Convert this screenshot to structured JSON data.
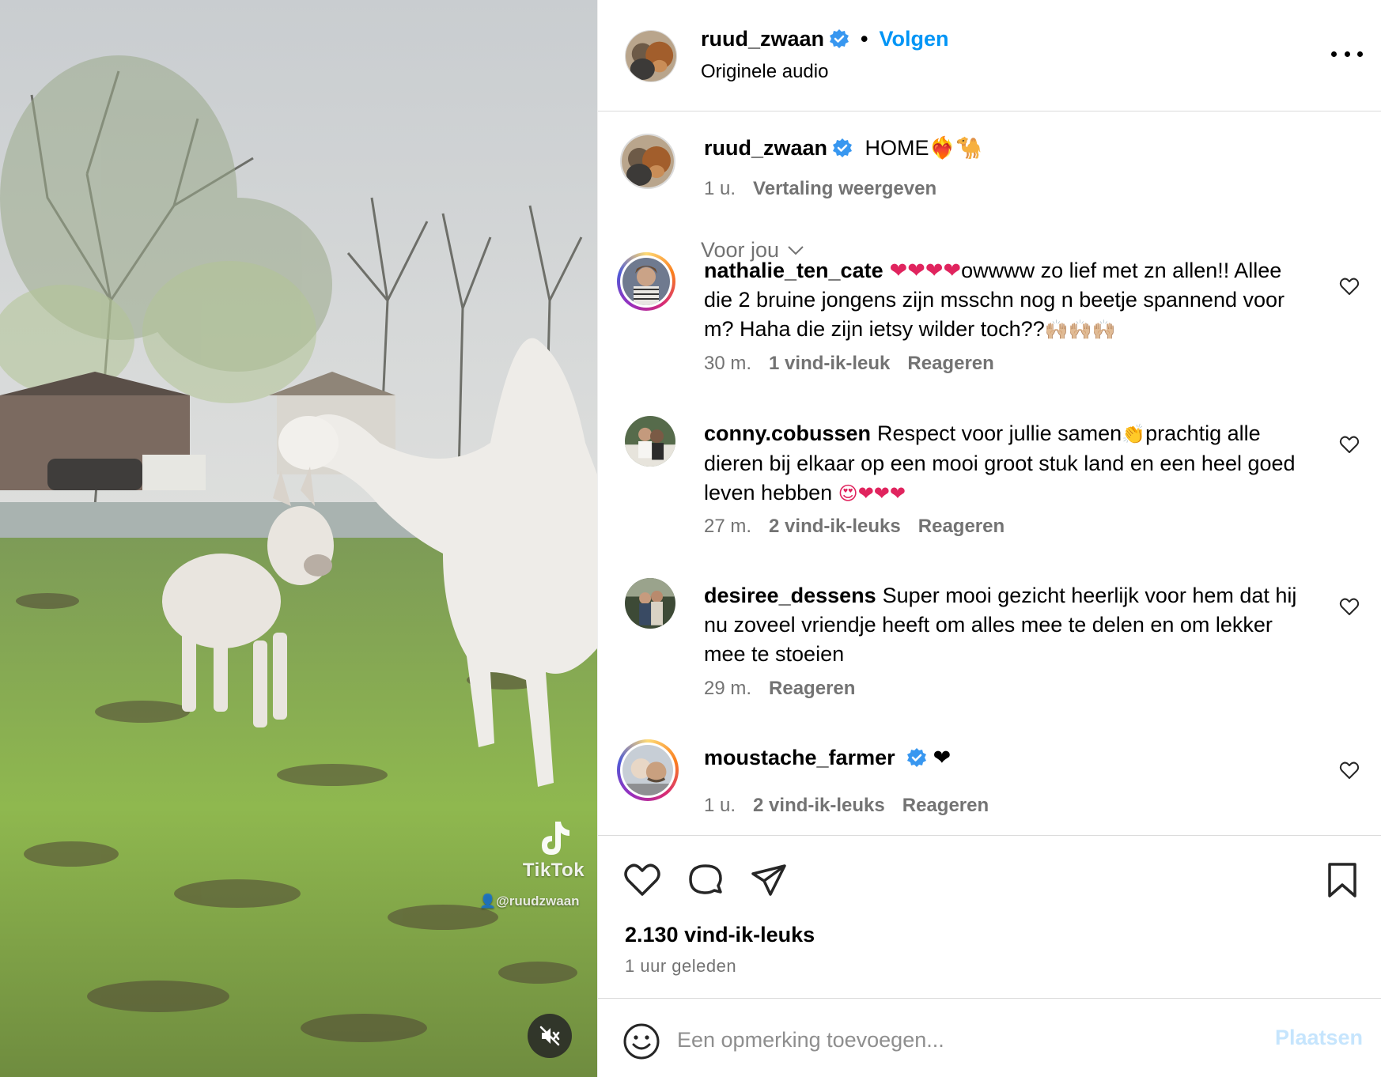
{
  "media": {
    "watermark_brand": "TikTok",
    "watermark_handle": "@ruudzwaan"
  },
  "post_header": {
    "username": "ruud_zwaan",
    "separator": "•",
    "follow_label": "Volgen",
    "audio_label": "Originele audio"
  },
  "caption": {
    "username": "ruud_zwaan",
    "text": "HOME❤️‍🔥🐪",
    "time": "1 u.",
    "translate_label": "Vertaling weergeven"
  },
  "sort_label": "Voor jou",
  "comments": [
    {
      "username": "nathalie_ten_cate",
      "hearts": "❤❤❤❤",
      "text": "owwww zo lief met zn allen!! Allee die 2 bruine jongens zijn msschn nog n beetje spannend voor m? Haha die zijn ietsy wilder toch??",
      "trail": "🙌🏼🙌🏼🙌🏼",
      "time": "30 m.",
      "likes": "1 vind-ik-leuk",
      "reply": "Reageren"
    },
    {
      "username": "conny.cobussen",
      "text": "Respect voor jullie samen",
      "emoji_mid": "👏",
      "text2": "prachtig alle dieren bij elkaar op een mooi groot stuk land en een heel goed leven hebben",
      "trail": "😍❤❤❤",
      "time": "27 m.",
      "likes": "2 vind-ik-leuks",
      "reply": "Reageren"
    },
    {
      "username": "desiree_dessens",
      "text": "Super mooi gezicht heerlijk voor hem dat hij nu zoveel vriendje heeft om alles mee te delen en om lekker mee te stoeien",
      "time": "29 m.",
      "reply": "Reageren"
    },
    {
      "username": "moustache_farmer",
      "text": "❤",
      "time": "1 u.",
      "likes": "2 vind-ik-leuks",
      "reply": "Reageren"
    }
  ],
  "footer": {
    "likes_count": "2.130 vind-ik-leuks",
    "posted_ago": "1 uur geleden",
    "comment_placeholder": "Een opmerking toevoegen...",
    "post_label": "Plaatsen"
  },
  "colors": {
    "accent": "#0095f6",
    "secondary_text": "#737373",
    "divider": "#dbdbdb",
    "post_disabled": "#c6e5fd",
    "verified": "#3897f0"
  }
}
